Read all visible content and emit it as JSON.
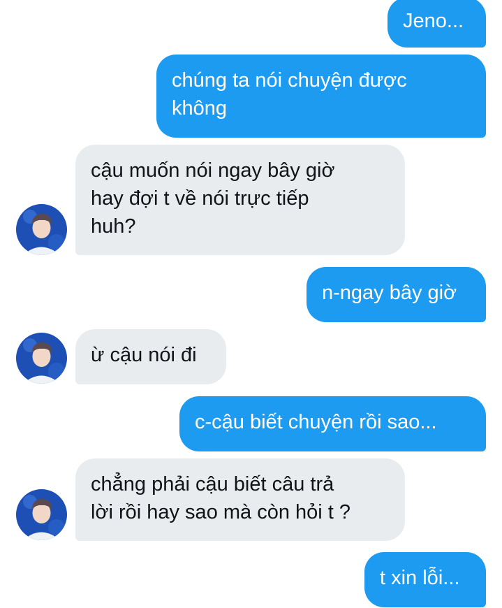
{
  "conversation": {
    "messages": [
      {
        "sender": "me",
        "text": "Jeno..."
      },
      {
        "sender": "me",
        "text": "chúng ta nói chuyện được\nkhông"
      },
      {
        "sender": "them",
        "text": "cậu muốn nói ngay bây giờ\nhay đợi t về nói trực tiếp\nhuh?"
      },
      {
        "sender": "me",
        "text": "n-ngay bây giờ"
      },
      {
        "sender": "them",
        "text": "ừ cậu nói đi"
      },
      {
        "sender": "me",
        "text": "c-cậu biết chuyện rồi sao..."
      },
      {
        "sender": "them",
        "text": "chẳng phải cậu biết câu trả\nlời rồi hay sao mà còn hỏi t ?"
      },
      {
        "sender": "me",
        "text": "t xin lỗi..."
      }
    ]
  },
  "colors": {
    "outgoing_bubble": "#1d9bf0",
    "incoming_bubble": "#e9ecef",
    "avatar_background": "#1d4fb5"
  },
  "icons": {
    "avatar": "contact-avatar-photo"
  }
}
